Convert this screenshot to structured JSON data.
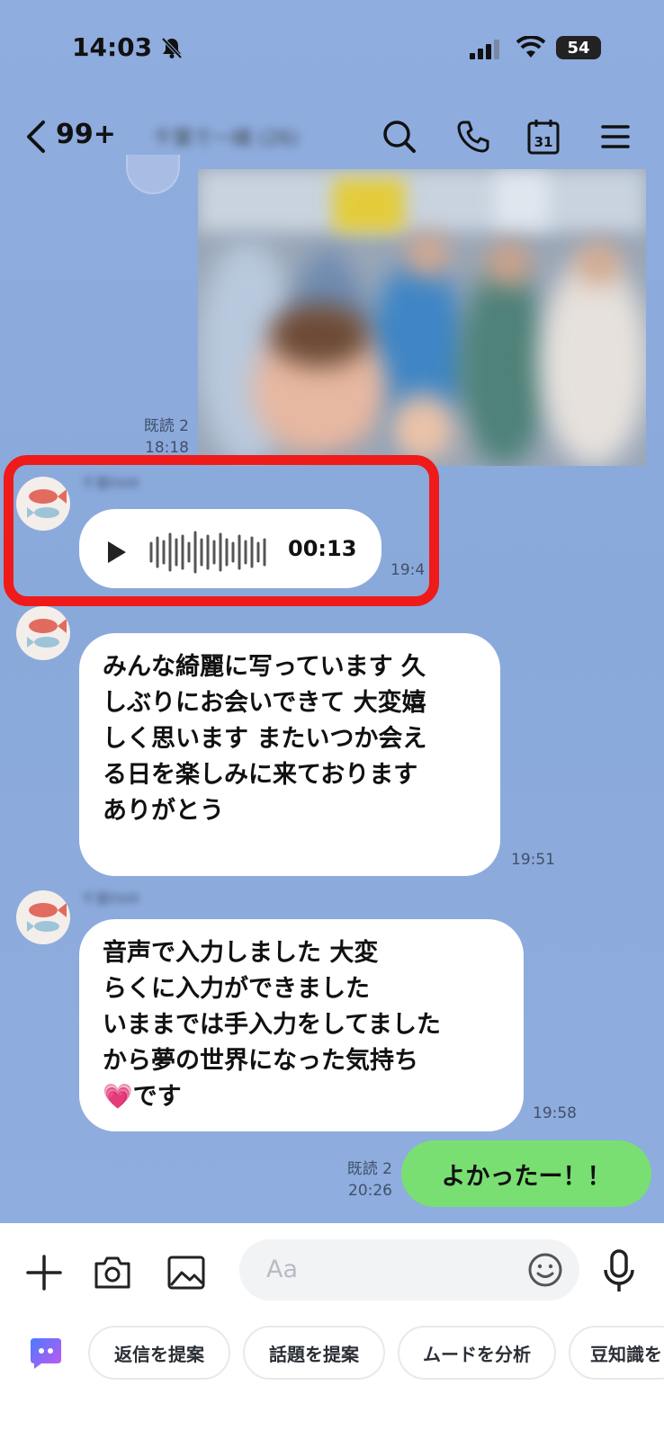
{
  "status_bar": {
    "time": "14:03",
    "battery": "54",
    "icons": [
      "bell-mute-icon",
      "signal-icon",
      "wifi-icon",
      "battery-icon"
    ]
  },
  "header": {
    "unread_count": "99+",
    "chat_name": "千葉で一緒 (26)",
    "icons": [
      "back-icon",
      "search-icon",
      "phone-icon",
      "calendar-icon",
      "menu-icon"
    ],
    "calendar_day": "31"
  },
  "messages": {
    "photo": {
      "read": "既読 2",
      "time": "18:18"
    },
    "voice": {
      "sender": "千葉FAM",
      "duration": "00:13",
      "time": "19:4"
    },
    "text1": {
      "text": "みんな綺麗に写っています 久\nしぶりにお会いできて 大変嬉\nしく思います またいつか会え\nる日を楽しみに来ております\nありがとう",
      "time": "19:51"
    },
    "text2": {
      "sender": "千葉FAM",
      "text": "音声で入力しました 大変\nらくに入力ができました\nいままでは手入力をしてました\nから夢の世界になった気持ち\n💗です",
      "time": "19:58"
    },
    "mine": {
      "text": "よかったー！！",
      "read": "既読 2",
      "time": "20:26"
    }
  },
  "input": {
    "placeholder": "Aa",
    "icons": [
      "plus-icon",
      "camera-icon",
      "image-icon",
      "emoji-icon",
      "mic-icon"
    ]
  },
  "suggestions": {
    "chips": [
      "返信を提案",
      "話題を提案",
      "ムードを分析",
      "豆知識を"
    ]
  },
  "colors": {
    "chat_bg": "#8dabdc",
    "my_bubble": "#79df72",
    "highlight": "#ef1a1a"
  }
}
